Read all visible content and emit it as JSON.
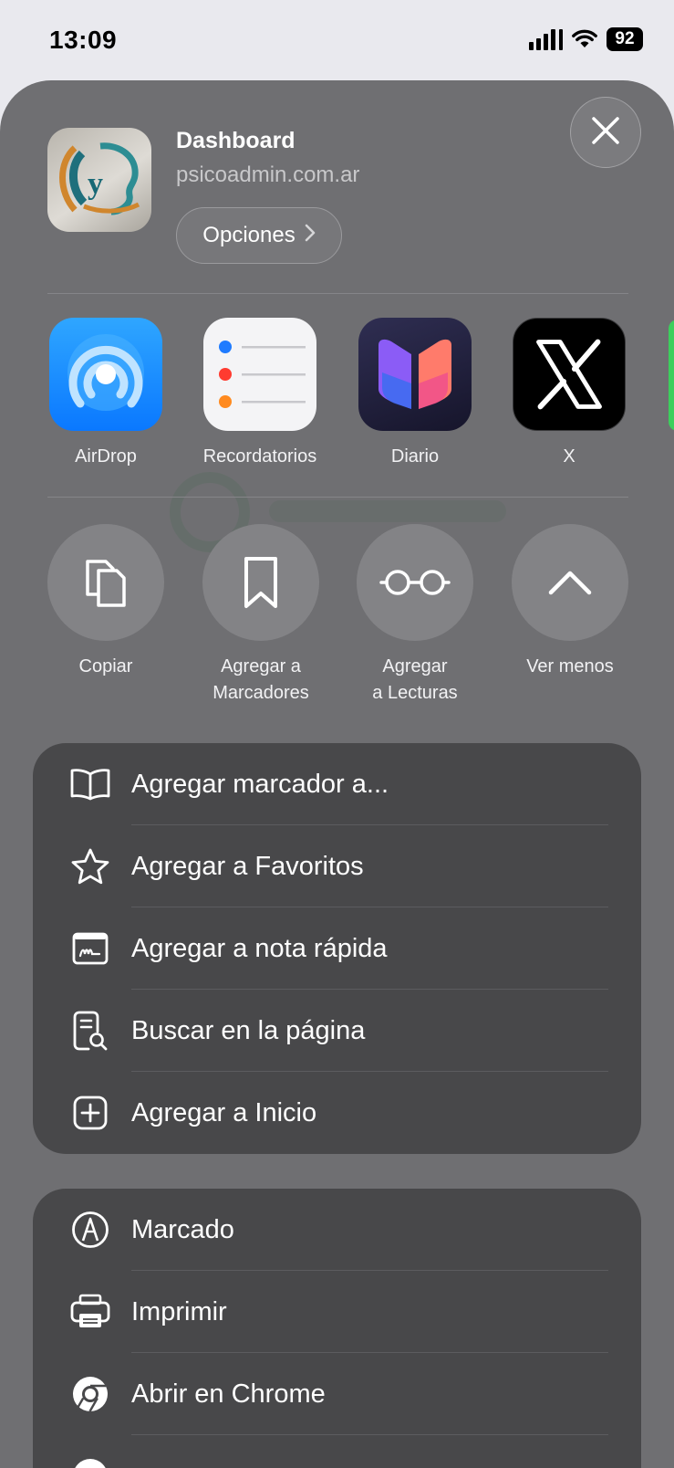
{
  "status_bar": {
    "time": "13:09",
    "battery": "92"
  },
  "header": {
    "title": "Dashboard",
    "url": "psicoadmin.com.ar",
    "options_label": "Opciones"
  },
  "apps": [
    {
      "label": "AirDrop",
      "icon": "airdrop-icon"
    },
    {
      "label": "Recordatorios",
      "icon": "reminders-icon"
    },
    {
      "label": "Diario",
      "icon": "journal-icon"
    },
    {
      "label": "X",
      "icon": "x-icon"
    }
  ],
  "actions": [
    {
      "label": "Copiar",
      "icon": "copy-icon"
    },
    {
      "label": "Agregar a\nMarcadores",
      "icon": "bookmark-icon"
    },
    {
      "label": "Agregar\na Lecturas",
      "icon": "glasses-icon"
    },
    {
      "label": "Ver menos",
      "icon": "chevron-up-icon"
    }
  ],
  "menu_group_1": [
    {
      "label": "Agregar marcador a...",
      "icon": "book-icon"
    },
    {
      "label": "Agregar a Favoritos",
      "icon": "star-icon"
    },
    {
      "label": "Agregar a nota rápida",
      "icon": "quick-note-icon"
    },
    {
      "label": "Buscar en la página",
      "icon": "find-in-page-icon"
    },
    {
      "label": "Agregar a Inicio",
      "icon": "add-square-icon"
    }
  ],
  "menu_group_2": [
    {
      "label": "Marcado",
      "icon": "markup-icon"
    },
    {
      "label": "Imprimir",
      "icon": "printer-icon"
    },
    {
      "label": "Abrir en Chrome",
      "icon": "chrome-icon"
    }
  ],
  "colors": {
    "sheet": "#6f6f72",
    "menu": "#48484a",
    "airdrop": "#1a8cff"
  }
}
